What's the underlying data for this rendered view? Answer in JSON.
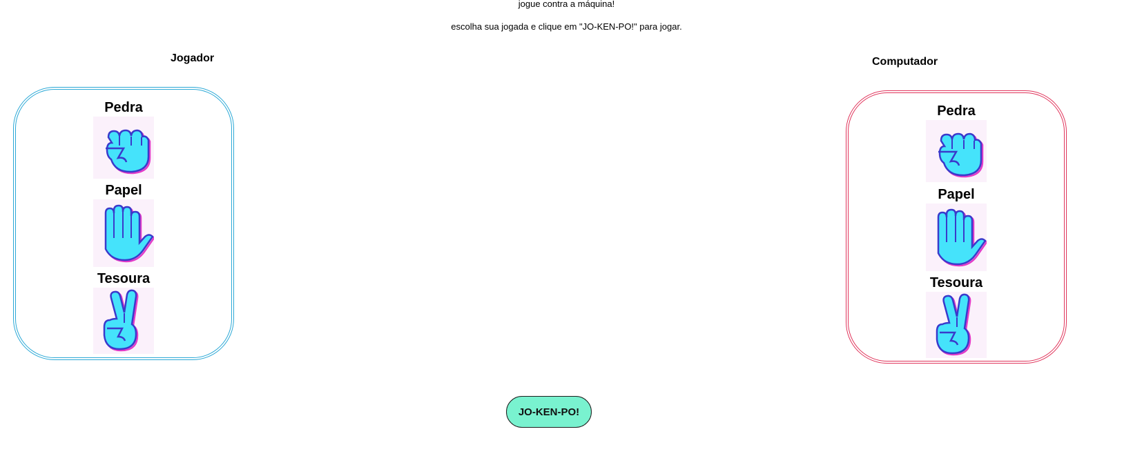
{
  "intro": {
    "line1": "jogue contra a máquina!",
    "line2": "escolha sua jogada e clique em \"JO-KEN-PO!\" para jogar."
  },
  "player": {
    "title": "Jogador",
    "choices": [
      {
        "label": "Pedra",
        "icon": "rock-fist-icon"
      },
      {
        "label": "Papel",
        "icon": "paper-hand-icon"
      },
      {
        "label": "Tesoura",
        "icon": "scissors-hand-icon"
      }
    ],
    "border_color": "#2aa8d6"
  },
  "computer": {
    "title": "Computador",
    "choices": [
      {
        "label": "Pedra",
        "icon": "rock-fist-icon"
      },
      {
        "label": "Papel",
        "icon": "paper-hand-icon"
      },
      {
        "label": "Tesoura",
        "icon": "scissors-hand-icon"
      }
    ],
    "border_color": "#e0335a"
  },
  "play_button": {
    "label": "JO-KEN-PO!",
    "color": "#79f2cf"
  },
  "colors": {
    "hand_fill": "#45e3fb",
    "hand_outline": "#3a3acb",
    "hand_shadow": "#e23bc8"
  }
}
